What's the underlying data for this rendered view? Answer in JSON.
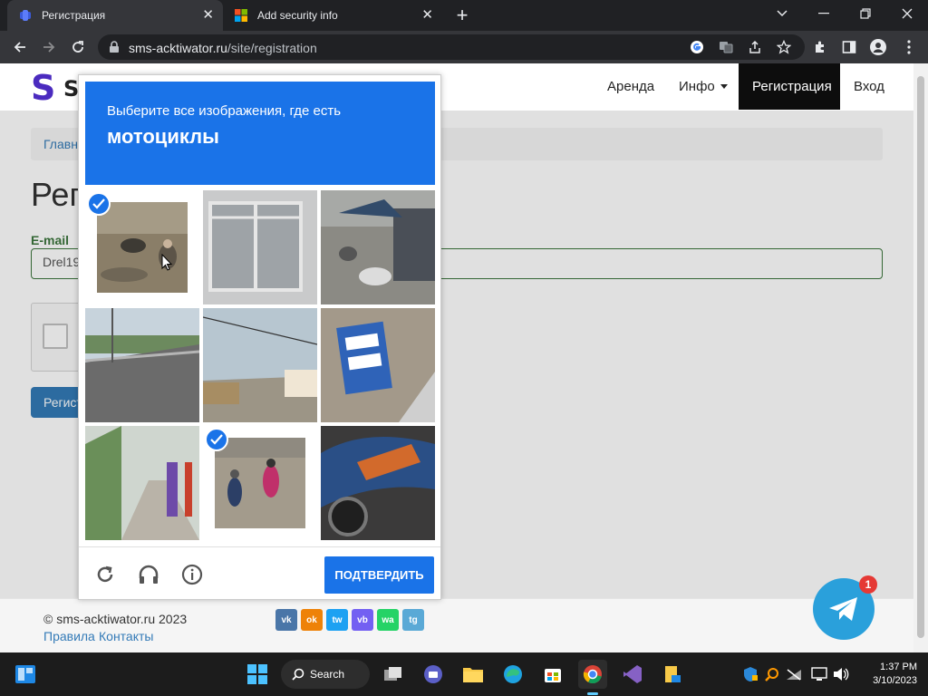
{
  "browser": {
    "tabs": [
      {
        "title": "Регистрация",
        "active": true
      },
      {
        "title": "Add security info",
        "active": false
      }
    ],
    "url_host": "sms-acktiwator.ru",
    "url_path": "/site/registration"
  },
  "site": {
    "logo_letter": "S",
    "logo_partial": "S",
    "nav": [
      "Аренда",
      "Инфо",
      "Регистрация",
      "Вход"
    ],
    "breadcrumb": "Главн",
    "page_title": "Рег",
    "email_label": "E-mail",
    "email_value": "Drel19",
    "submit_label": "Регист",
    "footer": {
      "copyright": "© sms-acktiwator.ru 2023",
      "links": [
        "Правила",
        "Контакты"
      ],
      "social": [
        {
          "name": "vk",
          "label": "vk",
          "color": "#4a76a8"
        },
        {
          "name": "odnoklassniki",
          "label": "ok",
          "color": "#ee8208"
        },
        {
          "name": "twitter",
          "label": "tw",
          "color": "#1da1f2"
        },
        {
          "name": "viber",
          "label": "vb",
          "color": "#7360f2"
        },
        {
          "name": "whatsapp",
          "label": "wa",
          "color": "#25d366"
        },
        {
          "name": "telegram",
          "label": "tg",
          "color": "#2aa0db"
        }
      ]
    },
    "telegram_badge": "1"
  },
  "captcha": {
    "prompt": "Выберите все изображения, где есть",
    "target": "мотоциклы",
    "verify_label": "ПОДТВЕРДИТЬ",
    "tiles": [
      {
        "selected": true
      },
      {
        "selected": false
      },
      {
        "selected": false
      },
      {
        "selected": false
      },
      {
        "selected": false
      },
      {
        "selected": false
      },
      {
        "selected": false
      },
      {
        "selected": true
      },
      {
        "selected": false
      }
    ],
    "accent": "#1a73e8"
  },
  "taskbar": {
    "search_label": "Search",
    "time": "1:37 PM",
    "date": "3/10/2023"
  }
}
